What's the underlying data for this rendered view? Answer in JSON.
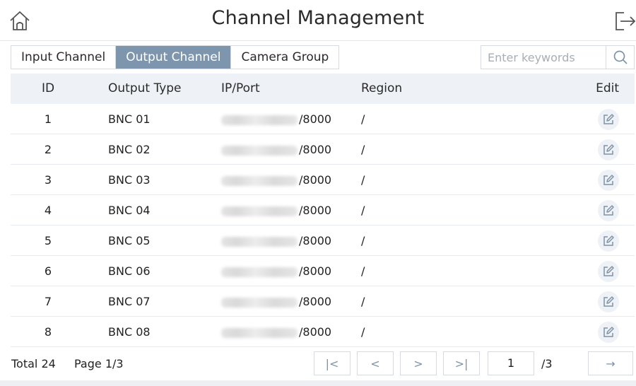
{
  "header": {
    "title": "Channel Management"
  },
  "tabs": [
    {
      "label": "Input Channel",
      "active": false
    },
    {
      "label": "Output Channel",
      "active": true
    },
    {
      "label": "Camera Group",
      "active": false
    }
  ],
  "search": {
    "placeholder": "Enter keywords",
    "value": ""
  },
  "table": {
    "columns": [
      "ID",
      "Output Type",
      "IP/Port",
      "Region",
      "Edit"
    ],
    "rows": [
      {
        "id": "1",
        "type": "BNC 01",
        "port": "/8000",
        "region": "/"
      },
      {
        "id": "2",
        "type": "BNC 02",
        "port": "/8000",
        "region": "/"
      },
      {
        "id": "3",
        "type": "BNC 03",
        "port": "/8000",
        "region": "/"
      },
      {
        "id": "4",
        "type": "BNC 04",
        "port": "/8000",
        "region": "/"
      },
      {
        "id": "5",
        "type": "BNC 05",
        "port": "/8000",
        "region": "/"
      },
      {
        "id": "6",
        "type": "BNC 06",
        "port": "/8000",
        "region": "/"
      },
      {
        "id": "7",
        "type": "BNC 07",
        "port": "/8000",
        "region": "/"
      },
      {
        "id": "8",
        "type": "BNC 08",
        "port": "/8000",
        "region": "/"
      }
    ]
  },
  "footer": {
    "total": "Total 24",
    "page_info": "Page 1/3",
    "first_symbol": "|<",
    "prev_symbol": "<",
    "next_symbol": ">",
    "last_symbol": ">|",
    "page_input": "1",
    "page_total": "/3",
    "go_symbol": "→"
  },
  "colors": {
    "active_tab": "#7e96ad",
    "header_row": "#eef1f5",
    "icon": "#7e93a8",
    "border": "#d7dbe0"
  },
  "icons": [
    "home-icon",
    "logout-icon",
    "search-icon",
    "edit-icon",
    "first-page-icon",
    "prev-page-icon",
    "next-page-icon",
    "last-page-icon",
    "go-arrow-icon"
  ]
}
